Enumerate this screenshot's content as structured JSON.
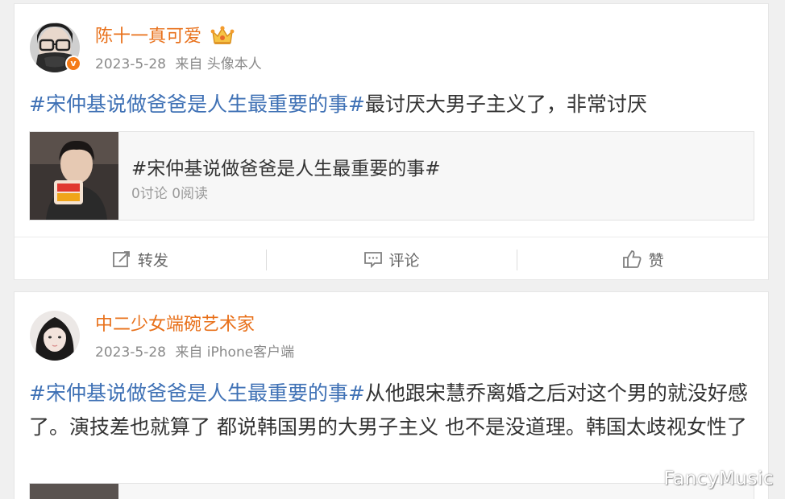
{
  "colors": {
    "username": "#e8701a",
    "hashtag": "#3f71b5",
    "meta": "#8a8a8a",
    "verified_badge": "#f47a16"
  },
  "posts": [
    {
      "username": "陈十一真可爱",
      "user_badge_icon": "crown-icon",
      "verified_icon": "verified-badge-icon",
      "date": "2023-5-28",
      "source": "来自 头像本人",
      "hashtag": "#宋仲基说做爸爸是人生最重要的事#",
      "body": "最讨厌大男子主义了，非常讨厌",
      "topic_card": {
        "title": "#宋仲基说做爸爸是人生最重要的事#",
        "stats": "0讨论 0阅读"
      },
      "actions": {
        "repost_label": "转发",
        "comment_label": "评论",
        "like_label": "赞"
      }
    },
    {
      "username": "中二少女端碗艺术家",
      "date": "2023-5-28",
      "source": "来自 iPhone客户端",
      "hashtag": "#宋仲基说做爸爸是人生最重要的事#",
      "body": "从他跟宋慧乔离婚之后对这个男的就没好感了。演技差也就算了 都说韩国男的大男子主义 也不是没道理。韩国太歧视女性了"
    }
  ],
  "watermark": "FancyMusic"
}
